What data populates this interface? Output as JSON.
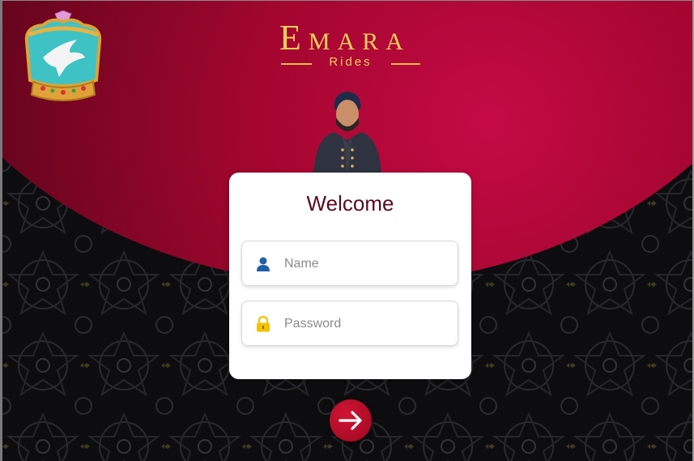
{
  "brand": {
    "first_letter": "E",
    "rest": "MARA",
    "subtitle": "Rides"
  },
  "login": {
    "title": "Welcome",
    "name_placeholder": "Name",
    "password_placeholder": "Password"
  },
  "icons": {
    "crown": "crown-eagle-logo",
    "user": "user-icon",
    "lock": "lock-icon",
    "submit": "arrow-right-icon"
  },
  "colors": {
    "crimson": "#a3062f",
    "gold": "#f3cf5a",
    "title": "#5a0a1f",
    "user_icon": "#1e5fa8",
    "lock_icon": "#f2c200",
    "submit": "#c2102e"
  }
}
